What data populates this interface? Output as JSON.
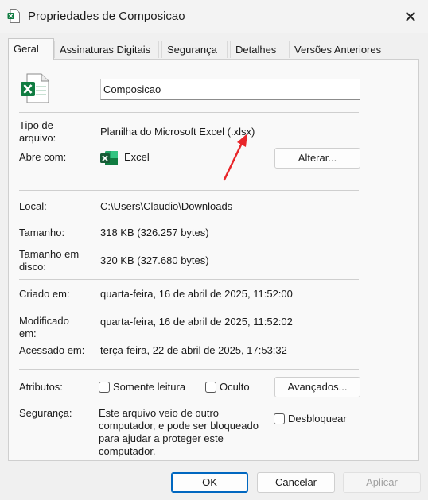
{
  "window": {
    "title": "Propriedades de Composicao",
    "close_glyph": "✕"
  },
  "tabs": [
    {
      "label": "Geral",
      "active": true
    },
    {
      "label": "Assinaturas Digitais"
    },
    {
      "label": "Segurança"
    },
    {
      "label": "Detalhes"
    },
    {
      "label": "Versões Anteriores"
    }
  ],
  "file": {
    "name": "Composicao",
    "type_label": "Tipo de arquivo:",
    "type_value": "Planilha do Microsoft Excel (.xlsx)",
    "opens_label": "Abre com:",
    "opens_value": "Excel",
    "change_button": "Alterar..."
  },
  "location": {
    "local_label": "Local:",
    "local_value": "C:\\Users\\Claudio\\Downloads",
    "size_label": "Tamanho:",
    "size_value": "318 KB (326.257 bytes)",
    "disk_size_label": "Tamanho em disco:",
    "disk_size_value": "320 KB (327.680 bytes)"
  },
  "dates": {
    "created_label": "Criado em:",
    "created_value": "quarta-feira, 16 de abril de 2025, 11:52:00",
    "modified_label": "Modificado em:",
    "modified_value": "quarta-feira, 16 de abril de 2025, 11:52:02",
    "accessed_label": "Acessado em:",
    "accessed_value": "terça-feira, 22 de abril de 2025, 17:53:32"
  },
  "attributes": {
    "label": "Atributos:",
    "readonly": "Somente leitura",
    "hidden": "Oculto",
    "advanced_button": "Avançados..."
  },
  "security": {
    "label": "Segurança:",
    "text": "Este arquivo veio de outro computador, e pode ser bloqueado para ajudar a proteger este computador.",
    "unblock": "Desbloquear"
  },
  "footer": {
    "ok": "OK",
    "cancel": "Cancelar",
    "apply": "Aplicar"
  },
  "colors": {
    "excel_green": "#107c41",
    "arrow_red": "#e8262a",
    "accent": "#0067c0"
  }
}
